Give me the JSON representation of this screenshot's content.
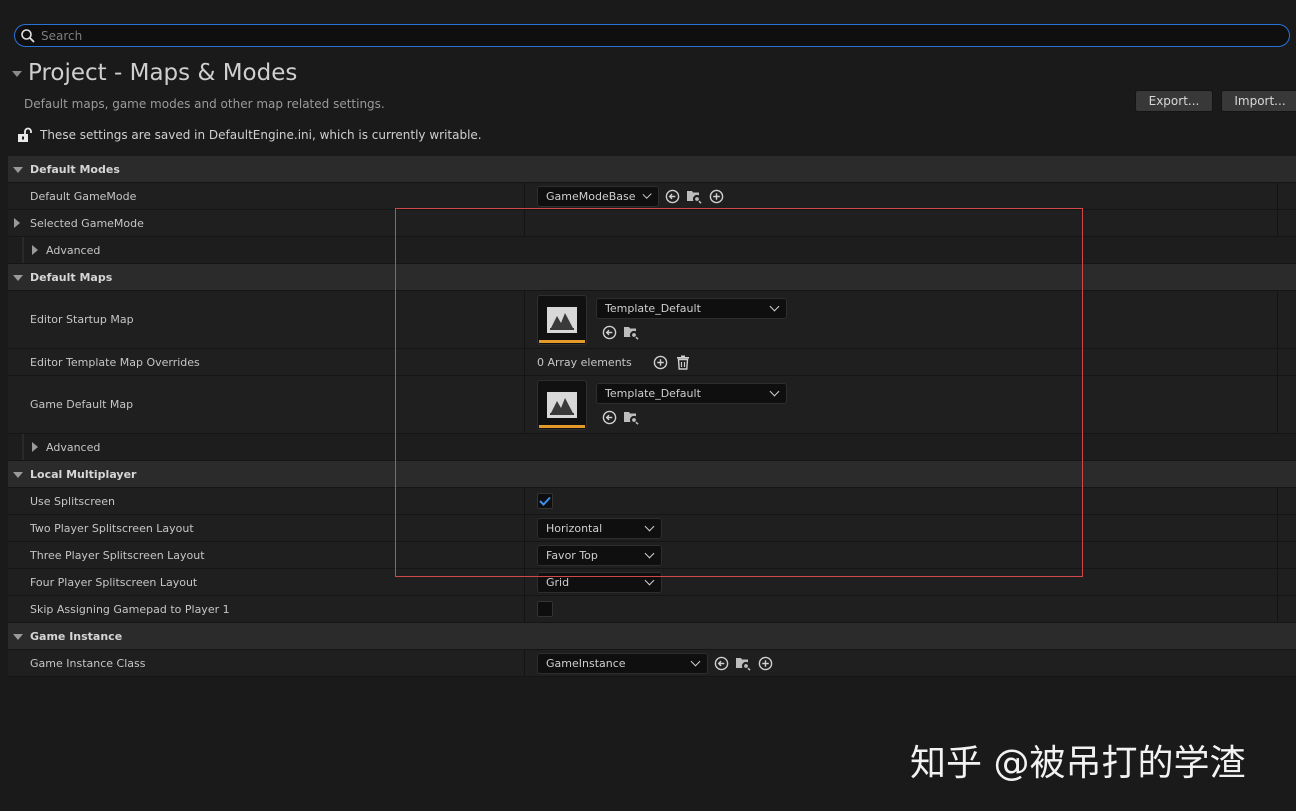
{
  "search": {
    "placeholder": "Search"
  },
  "header": {
    "title": "Project - Maps & Modes",
    "subtitle": "Default maps, game modes and other map related settings.",
    "writable_note": "These settings are saved in DefaultEngine.ini, which is currently writable.",
    "export_label": "Export...",
    "import_label": "Import..."
  },
  "sections": {
    "default_modes": {
      "label": "Default Modes",
      "default_gamemode": {
        "label": "Default GameMode",
        "value": "GameModeBase"
      },
      "selected_gamemode": {
        "label": "Selected GameMode"
      },
      "advanced": {
        "label": "Advanced"
      }
    },
    "default_maps": {
      "label": "Default Maps",
      "editor_startup_map": {
        "label": "Editor Startup Map",
        "value": "Template_Default"
      },
      "editor_template_overrides": {
        "label": "Editor Template Map Overrides",
        "value": "0 Array elements"
      },
      "game_default_map": {
        "label": "Game Default Map",
        "value": "Template_Default"
      },
      "advanced": {
        "label": "Advanced"
      }
    },
    "local_multiplayer": {
      "label": "Local Multiplayer",
      "use_splitscreen": {
        "label": "Use Splitscreen",
        "checked": true
      },
      "two_player": {
        "label": "Two Player Splitscreen Layout",
        "value": "Horizontal"
      },
      "three_player": {
        "label": "Three Player Splitscreen Layout",
        "value": "Favor Top"
      },
      "four_player": {
        "label": "Four Player Splitscreen Layout",
        "value": "Grid"
      },
      "skip_gamepad": {
        "label": "Skip Assigning Gamepad to Player 1",
        "checked": false
      }
    },
    "game_instance": {
      "label": "Game Instance",
      "game_instance_class": {
        "label": "Game Instance Class",
        "value": "GameInstance"
      }
    }
  },
  "watermark": "知乎 @被吊打的学渣",
  "colors": {
    "accent": "#2a72d6",
    "asset_bar": "#e49a2a",
    "highlight_box": "#d04848",
    "checkbox_check": "#3b8ff0"
  }
}
